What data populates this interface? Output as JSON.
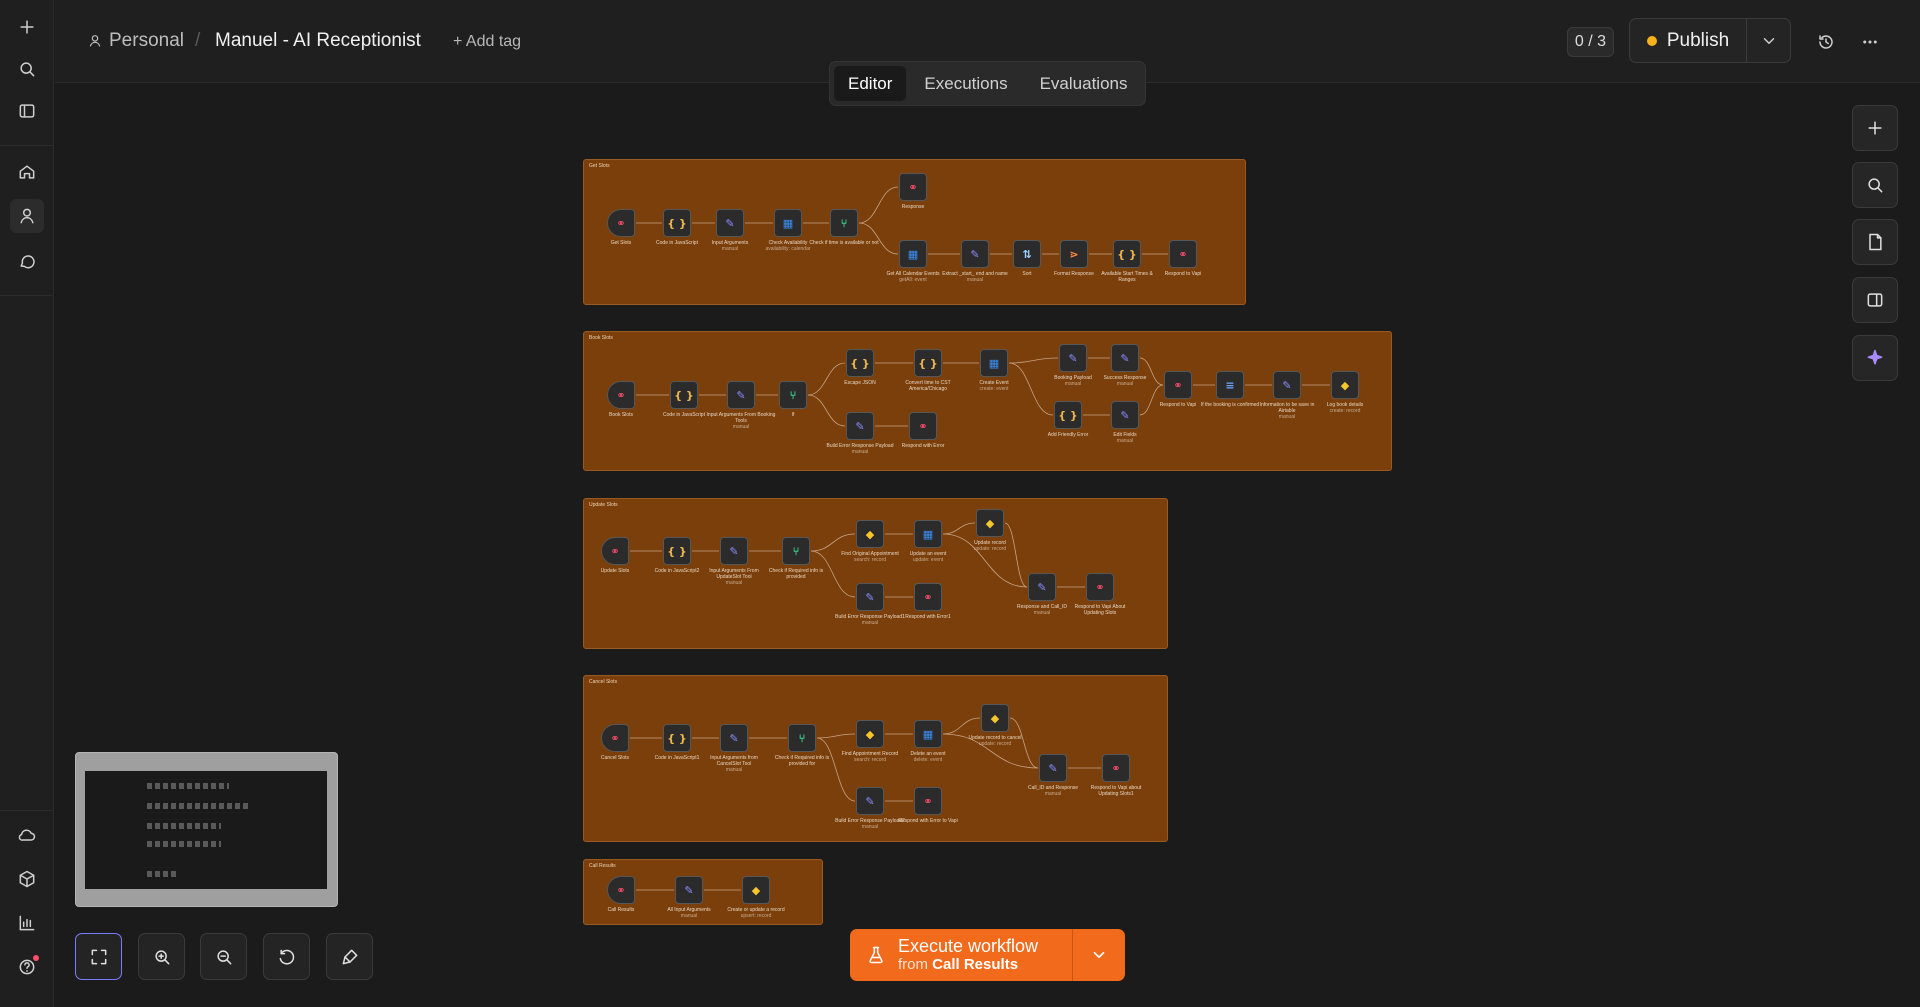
{
  "header": {
    "project": "Personal",
    "separator": "/",
    "workflow_title": "Manuel - AI Receptionist",
    "add_tag": "+ Add tag",
    "counter": "0 / 3",
    "publish_label": "Publish",
    "publish_status_color": "#f6b21b"
  },
  "tabs": [
    {
      "label": "Editor",
      "active": true
    },
    {
      "label": "Executions",
      "active": false
    },
    {
      "label": "Evaluations",
      "active": false
    }
  ],
  "left_rail_icons": [
    "plus-icon",
    "search-icon",
    "sidebar-toggle-icon",
    "home-icon",
    "user-icon",
    "chat-icon",
    "cloud-icon",
    "cube-icon",
    "chart-icon",
    "help-icon"
  ],
  "right_tools": [
    "add-node-icon",
    "search-nodes-icon",
    "sticky-note-icon",
    "side-panel-icon",
    "ai-assistant-icon"
  ],
  "canvas_controls": [
    "fit-view-icon",
    "zoom-in-icon",
    "zoom-out-icon",
    "undo-icon",
    "tidy-up-icon"
  ],
  "execute": {
    "label": "Execute workflow",
    "sub_prefix": "from",
    "sub_node": "Call Results"
  },
  "groups": [
    {
      "label": "Get Slots",
      "nodes": [
        {
          "label": "Get Slots",
          "sub": "",
          "kind": "webhook"
        },
        {
          "label": "Code in JavaScript",
          "sub": "",
          "kind": "code"
        },
        {
          "label": "Input Arguments",
          "sub": "manual",
          "kind": "edit"
        },
        {
          "label": "Check Availability",
          "sub": "availability: calendar",
          "kind": "calendar"
        },
        {
          "label": "Check if time is available or not",
          "sub": "",
          "kind": "if"
        },
        {
          "label": "Response",
          "sub": "",
          "kind": "webhook"
        },
        {
          "label": "Get All Calendar Events",
          "sub": "getAll: event",
          "kind": "calendar"
        },
        {
          "label": "Extract _start_ end and name",
          "sub": "manual",
          "kind": "edit"
        },
        {
          "label": "Sort",
          "sub": "",
          "kind": "sort"
        },
        {
          "label": "Format Response",
          "sub": "",
          "kind": "merge"
        },
        {
          "label": "Available Start Times & Ranges",
          "sub": "",
          "kind": "code"
        },
        {
          "label": "Respond to Vapi",
          "sub": "",
          "kind": "webhook"
        }
      ]
    },
    {
      "label": "Book Slots",
      "nodes": [
        {
          "label": "Book Slots",
          "sub": "",
          "kind": "webhook"
        },
        {
          "label": "Code in JavaScript",
          "sub": "",
          "kind": "code"
        },
        {
          "label": "Input Arguments From Booking Tools",
          "sub": "manual",
          "kind": "edit"
        },
        {
          "label": "If",
          "sub": "",
          "kind": "if"
        },
        {
          "label": "Escape JSON",
          "sub": "",
          "kind": "code"
        },
        {
          "label": "Convert time to CST America/Chicago",
          "sub": "",
          "kind": "code"
        },
        {
          "label": "Create Event",
          "sub": "create: event",
          "kind": "calendar"
        },
        {
          "label": "Booking Payload",
          "sub": "manual",
          "kind": "edit"
        },
        {
          "label": "Success Response",
          "sub": "manual",
          "kind": "edit"
        },
        {
          "label": "Add Friendly Error",
          "sub": "",
          "kind": "code"
        },
        {
          "label": "Edit Fields",
          "sub": "manual",
          "kind": "edit"
        },
        {
          "label": "Respond to Vapi",
          "sub": "",
          "kind": "webhook"
        },
        {
          "label": "If the booking is confirmed",
          "sub": "",
          "kind": "filter"
        },
        {
          "label": "Information to be save in Airtable",
          "sub": "manual",
          "kind": "edit"
        },
        {
          "label": "Log book details",
          "sub": "create: record",
          "kind": "airtable"
        },
        {
          "label": "Build Error Response Payload",
          "sub": "manual",
          "kind": "edit"
        },
        {
          "label": "Respond with Error",
          "sub": "",
          "kind": "webhook"
        }
      ]
    },
    {
      "label": "Update Slots",
      "nodes": [
        {
          "label": "Update Slots",
          "sub": "",
          "kind": "webhook"
        },
        {
          "label": "Code in JavaScript2",
          "sub": "",
          "kind": "code"
        },
        {
          "label": "Input Arguments From UpdateSlot Tool",
          "sub": "manual",
          "kind": "edit"
        },
        {
          "label": "Check if Required info is provided",
          "sub": "",
          "kind": "if"
        },
        {
          "label": "Find Original Appointment",
          "sub": "search: record",
          "kind": "airtable"
        },
        {
          "label": "Update an event",
          "sub": "update: event",
          "kind": "calendar"
        },
        {
          "label": "Update record",
          "sub": "update: record",
          "kind": "airtable"
        },
        {
          "label": "Response and Call_ID",
          "sub": "manual",
          "kind": "edit"
        },
        {
          "label": "Respond to Vapi About Updating Slots",
          "sub": "",
          "kind": "webhook"
        },
        {
          "label": "Build Error Response Payload1",
          "sub": "manual",
          "kind": "edit"
        },
        {
          "label": "Respond with Error1",
          "sub": "",
          "kind": "webhook"
        }
      ]
    },
    {
      "label": "Cancel Slots",
      "nodes": [
        {
          "label": "Cancel Slots",
          "sub": "",
          "kind": "webhook"
        },
        {
          "label": "Code in JavaScript1",
          "sub": "",
          "kind": "code"
        },
        {
          "label": "Input Arguments from CancelSlot Tool",
          "sub": "manual",
          "kind": "edit"
        },
        {
          "label": "Check if Required info is provided for",
          "sub": "",
          "kind": "if"
        },
        {
          "label": "Find Appointment Record",
          "sub": "search: record",
          "kind": "airtable"
        },
        {
          "label": "Delete an event",
          "sub": "delete: event",
          "kind": "calendar"
        },
        {
          "label": "Update record to cancel",
          "sub": "update: record",
          "kind": "airtable"
        },
        {
          "label": "Call_ID and Response",
          "sub": "manual",
          "kind": "edit"
        },
        {
          "label": "Respond to Vapi about Updating Slots1",
          "sub": "",
          "kind": "webhook"
        },
        {
          "label": "Build Error Response Payload2",
          "sub": "manual",
          "kind": "edit"
        },
        {
          "label": "Respond with Error to Vapi",
          "sub": "",
          "kind": "webhook"
        }
      ]
    },
    {
      "label": "Call Results",
      "nodes": [
        {
          "label": "Call Results",
          "sub": "",
          "kind": "webhook"
        },
        {
          "label": "All Input Arguments",
          "sub": "manual",
          "kind": "edit"
        },
        {
          "label": "Create or update a record",
          "sub": "upsert: record",
          "kind": "airtable"
        }
      ]
    }
  ],
  "node_icons": {
    "webhook": {
      "glyph": "⚭",
      "color": "#ff4d6a"
    },
    "code": {
      "glyph": "{ }",
      "color": "#f2b84b"
    },
    "edit": {
      "glyph": "✎",
      "color": "#8b8cff"
    },
    "calendar": {
      "glyph": "▦",
      "color": "#3b8ff5"
    },
    "if": {
      "glyph": "⑂",
      "color": "#3ccf8e"
    },
    "sort": {
      "glyph": "⇅",
      "color": "#9ad1ff"
    },
    "merge": {
      "glyph": "⋗",
      "color": "#ff8a3d"
    },
    "filter": {
      "glyph": "≡",
      "color": "#6aa7ff"
    },
    "airtable": {
      "glyph": "◆",
      "color": "#f7c52d"
    }
  }
}
